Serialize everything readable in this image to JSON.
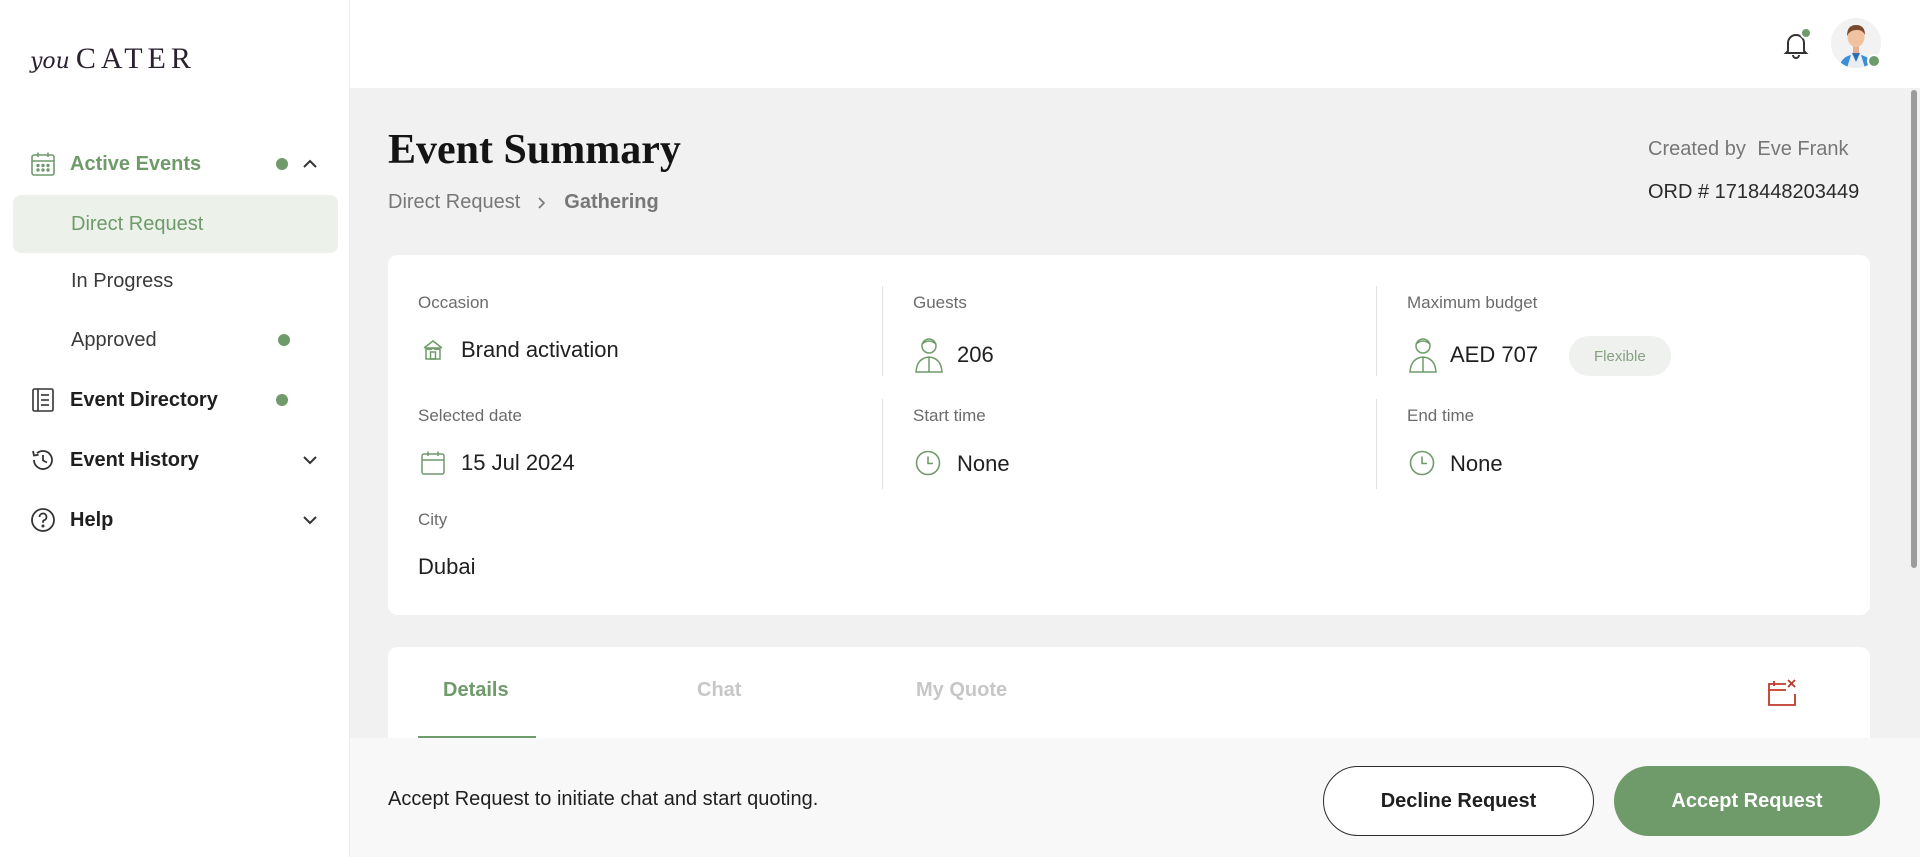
{
  "brand": {
    "logo_you": "you",
    "logo_cater": "CATER"
  },
  "sidebar": {
    "active_events_label": "Active Events",
    "sub_items": [
      {
        "label": "Direct Request"
      },
      {
        "label": "In Progress"
      },
      {
        "label": "Approved"
      }
    ],
    "event_directory_label": "Event Directory",
    "event_history_label": "Event History",
    "help_label": "Help"
  },
  "header": {
    "title": "Event Summary",
    "breadcrumb": [
      "Direct Request",
      "Gathering"
    ],
    "created_by_label": "Created by",
    "created_by_name": "Eve Frank",
    "order": "ORD # 1718448203449"
  },
  "summary": {
    "occasion": {
      "label": "Occasion",
      "value": "Brand activation"
    },
    "guests": {
      "label": "Guests",
      "value": "206"
    },
    "budget": {
      "label": "Maximum budget",
      "value": "AED 707",
      "badge": "Flexible"
    },
    "selected_date": {
      "label": "Selected date",
      "value": "15 Jul 2024"
    },
    "start_time": {
      "label": "Start time",
      "value": "None"
    },
    "end_time": {
      "label": "End time",
      "value": "None"
    },
    "city": {
      "label": "City",
      "value": "Dubai"
    }
  },
  "tabs": [
    {
      "label": "Details"
    },
    {
      "label": "Chat"
    },
    {
      "label": "My Quote"
    }
  ],
  "footer": {
    "hint": "Accept Request to initiate chat and start quoting.",
    "decline_label": "Decline Request",
    "accept_label": "Accept Request"
  },
  "colors": {
    "accent": "#6f9a6a",
    "accent_light": "#ecf2ea",
    "danger": "#c0392b"
  }
}
